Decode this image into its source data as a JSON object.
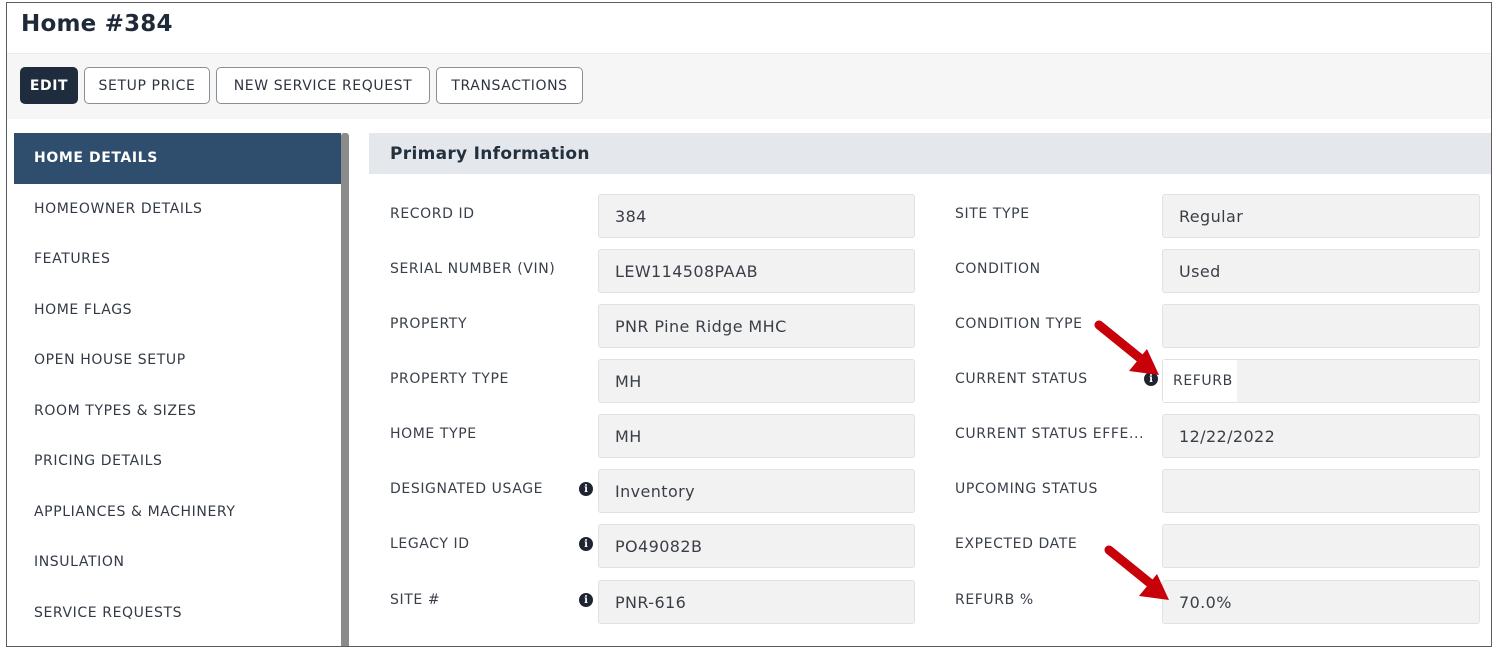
{
  "page": {
    "title": "Home #384"
  },
  "toolbar": {
    "edit": "EDIT",
    "setup_price": "SETUP PRICE",
    "new_service_request": "NEW SERVICE REQUEST",
    "transactions": "TRANSACTIONS"
  },
  "sidebar": {
    "items": [
      {
        "label": "HOME DETAILS",
        "active": true
      },
      {
        "label": "HOMEOWNER DETAILS"
      },
      {
        "label": "FEATURES"
      },
      {
        "label": "HOME FLAGS"
      },
      {
        "label": "OPEN HOUSE SETUP"
      },
      {
        "label": "ROOM TYPES & SIZES"
      },
      {
        "label": "PRICING DETAILS"
      },
      {
        "label": "APPLIANCES & MACHINERY"
      },
      {
        "label": "INSULATION"
      },
      {
        "label": "SERVICE REQUESTS"
      }
    ]
  },
  "primary_info": {
    "header": "Primary Information",
    "left": [
      {
        "label": "RECORD ID",
        "value": "384"
      },
      {
        "label": "SERIAL NUMBER (VIN)",
        "value": "LEW114508PAAB"
      },
      {
        "label": "PROPERTY",
        "value": "PNR Pine Ridge MHC"
      },
      {
        "label": "PROPERTY TYPE",
        "value": "MH"
      },
      {
        "label": "HOME TYPE",
        "value": "MH"
      },
      {
        "label": "DESIGNATED USAGE",
        "value": "Inventory",
        "info": "i"
      },
      {
        "label": "LEGACY ID",
        "value": "PO49082B",
        "info": "i"
      },
      {
        "label": "SITE #",
        "value": "PNR-616",
        "info": "i"
      }
    ],
    "right": [
      {
        "label": "SITE TYPE",
        "value": "Regular"
      },
      {
        "label": "CONDITION",
        "value": "Used"
      },
      {
        "label": "CONDITION TYPE",
        "value": ""
      },
      {
        "label": "CURRENT STATUS",
        "value": "REFURB",
        "info": "i"
      },
      {
        "label": "CURRENT STATUS EFFE...",
        "value": "12/22/2022"
      },
      {
        "label": "UPCOMING STATUS",
        "value": ""
      },
      {
        "label": "EXPECTED DATE",
        "value": ""
      },
      {
        "label": "REFURB %",
        "value": "70.0%"
      }
    ]
  },
  "colors": {
    "primary_button": "#1f2c3d",
    "sidebar_active": "#2f4d6c",
    "annotation_arrow": "#c8000a"
  }
}
